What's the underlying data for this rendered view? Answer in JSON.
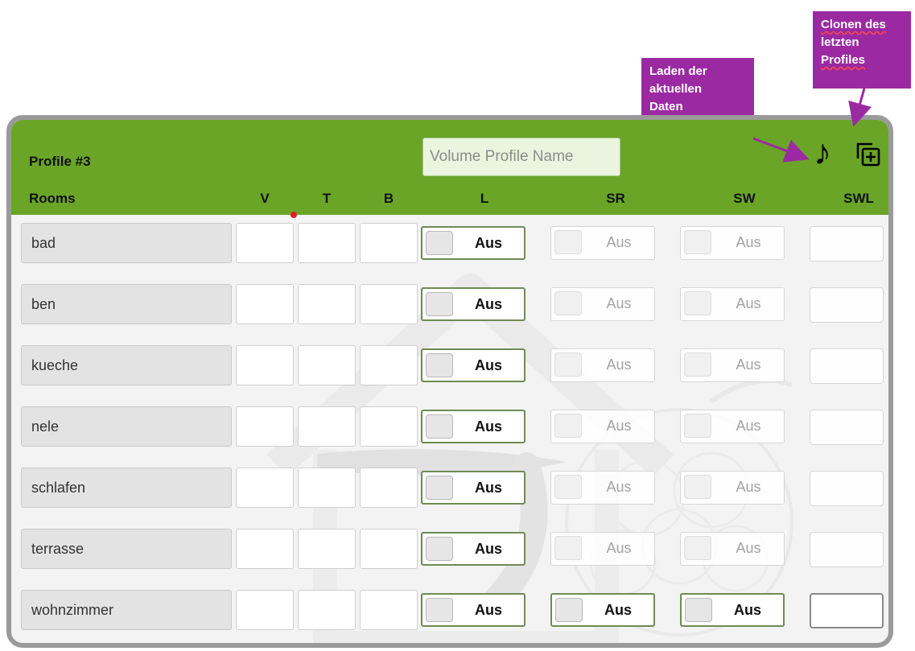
{
  "callouts": {
    "clone": [
      "Clonen des",
      "letzten",
      "Profiles"
    ],
    "load": [
      "Laden der",
      "aktuellen",
      "Daten"
    ]
  },
  "header": {
    "profile_title": "Profile #3",
    "volume_placeholder": "Volume Profile Name",
    "icons": {
      "load": "music-note-icon",
      "clone": "clone-icon"
    }
  },
  "columns": {
    "rooms": "Rooms",
    "v": "V",
    "t": "T",
    "b": "B",
    "l": "L",
    "sr": "SR",
    "sw": "SW",
    "swl": "SWL"
  },
  "toggle_label": "Aus",
  "rows": [
    {
      "room": "bad",
      "sr_enabled": false,
      "sw_enabled": false,
      "swl_enabled": false
    },
    {
      "room": "ben",
      "sr_enabled": false,
      "sw_enabled": false,
      "swl_enabled": false
    },
    {
      "room": "kueche",
      "sr_enabled": false,
      "sw_enabled": false,
      "swl_enabled": false
    },
    {
      "room": "nele",
      "sr_enabled": false,
      "sw_enabled": false,
      "swl_enabled": false
    },
    {
      "room": "schlafen",
      "sr_enabled": false,
      "sw_enabled": false,
      "swl_enabled": false
    },
    {
      "room": "terrasse",
      "sr_enabled": false,
      "sw_enabled": false,
      "swl_enabled": false
    },
    {
      "room": "wohnzimmer",
      "sr_enabled": true,
      "sw_enabled": true,
      "swl_enabled": true
    }
  ],
  "colors": {
    "header_green": "#6aa528",
    "callout_purple": "#9b2aa2",
    "panel_border": "#9a9a9a"
  }
}
